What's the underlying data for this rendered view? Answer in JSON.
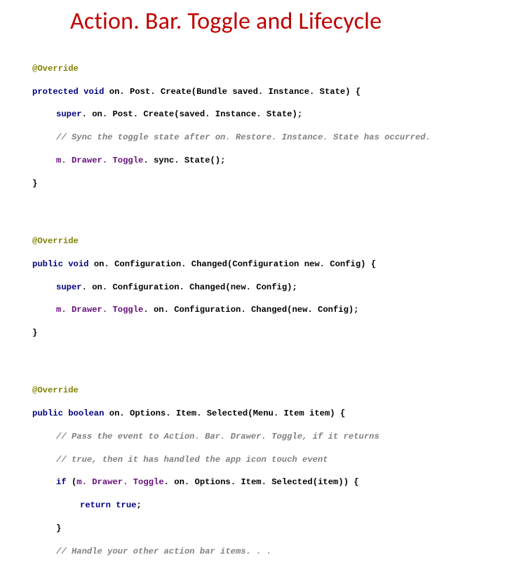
{
  "title": "Action. Bar. Toggle and Lifecycle",
  "c": {
    "ov": "@Override",
    "prot": "protected",
    "pub": "public",
    "void": "void",
    "bool": "boolean",
    "super": "super",
    "if": "if",
    "ret": "return",
    "true": "true",
    "lb": "{",
    "rb": "}",
    "lp": "(",
    "rp": ")",
    "sc": ";",
    "d": ". ",
    "sp": " ",
    "Bundle": "Bundle",
    "saved": "saved. Instance. State",
    "onPostCreate": "on. Post. Create",
    "syncState": "sync. State",
    "mToggle": "m. Drawer. Toggle",
    "cmt1": "// Sync the toggle state after on. Restore. Instance. State has occurred.",
    "onConfigChanged": "on. Configuration. Changed",
    "Configuration": "Configuration",
    "newConfig": "new. Config",
    "onOptSel": "on. Options. Item. Selected",
    "MenuItem": "Menu. Item",
    "item": "item",
    "cmt2": "// Pass the event to Action. Bar. Drawer. Toggle, if it returns",
    "cmt3": "// true, then it has handled the app icon touch event",
    "cmt4": "// Handle your other action bar items. . ."
  }
}
